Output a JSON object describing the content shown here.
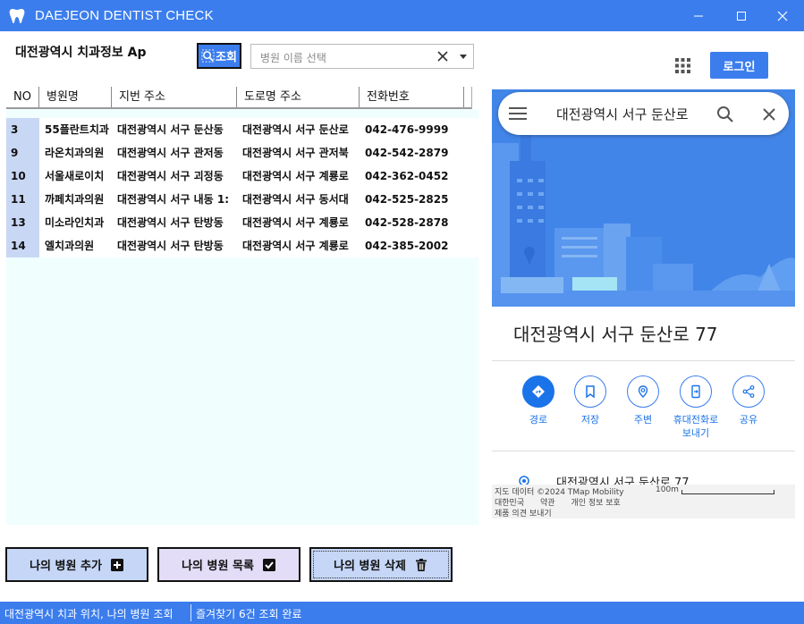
{
  "window": {
    "title": "DAEJEON DENTIST CHECK",
    "app_icon": "tooth-icon",
    "controls": [
      "minimize-icon",
      "maximize-icon",
      "close-icon"
    ]
  },
  "header": {
    "region_label": "대전광역시 치과정보 Ap",
    "search_button_label": "조회",
    "hospital_select_placeholder": "병원 이름 선택",
    "login_label": "로그인"
  },
  "table": {
    "columns": [
      "NO",
      "병원명",
      "지번 주소",
      "도로명 주소",
      "전화번호"
    ],
    "rows": [
      [
        "3",
        "55플란트치과",
        "대전광역시 서구 둔산동",
        "대전광역시 서구 둔산로",
        "042-476-9999"
      ],
      [
        "9",
        "라온치과의원",
        "대전광역시 서구 관저동",
        "대전광역시 서구 관저북",
        "042-542-2879"
      ],
      [
        "10",
        "서울새로이치",
        "대전광역시 서구 괴정동",
        "대전광역시 서구 계룡로",
        "042-362-0452"
      ],
      [
        "11",
        "까페치과의원",
        "대전광역시 서구 내동 1:",
        "대전광역시 서구 동서대",
        "042-525-2825"
      ],
      [
        "13",
        "미소라인치과",
        "대전광역시 서구 탄방동",
        "대전광역시 서구 계룡로",
        "042-528-2878"
      ],
      [
        "14",
        "엘치과의원",
        "대전광역시 서구 탄방동",
        "대전광역시 서구 계룡로",
        "042-385-2002"
      ]
    ]
  },
  "map": {
    "search_query": "대전광역시 서구 둔산로",
    "place_title": "대전광역시 서구 둔산로 77",
    "actions": [
      {
        "label": "경로",
        "icon": "directions-icon"
      },
      {
        "label": "저장",
        "icon": "bookmark-icon"
      },
      {
        "label": "주변",
        "icon": "nearby-icon"
      },
      {
        "label": "휴대전화로\n보내기",
        "icon": "send-to-phone-icon"
      },
      {
        "label": "공유",
        "icon": "share-icon"
      }
    ],
    "address_line": "대전광역시 서구 둔산로 77",
    "footer": {
      "attribution": "지도 데이터 ©2024 TMap Mobility",
      "scale": "100m",
      "links": [
        "대한민국",
        "약관",
        "개인 정보 보호"
      ],
      "feedback": "제품 의견 보내기"
    }
  },
  "buttons": {
    "add": "나의 병원 추가",
    "list": "나의 병원 목록",
    "delete": "나의 병원 삭제"
  },
  "status": {
    "left": "대전광역시 치과 위치, 나의 병원 조회",
    "right": "즐겨찾기 6건 조회 완료"
  },
  "colors": {
    "accent": "#3b7ded",
    "table_bg": "#f0fefe",
    "no_cell": "#c8d7f4"
  }
}
